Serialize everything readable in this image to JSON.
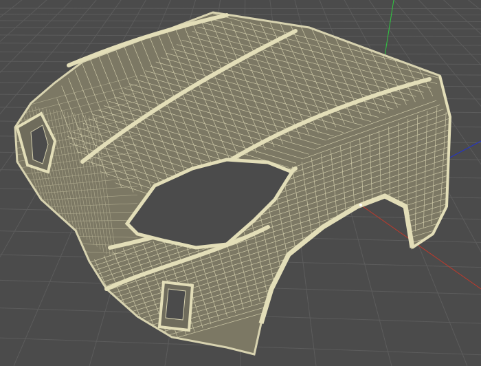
{
  "viewport": {
    "kind": "3d-perspective-viewport",
    "view_mode": "wireframe-on-shaded",
    "background_color": "#4b4b4b",
    "grid_color": "#5c5c5c",
    "grid_major_color": "#383838",
    "model": {
      "name": "",
      "description_icon": "car-front-body-mesh-icon",
      "surface_color": "#7c7864",
      "wire_color": "#d8d3b0",
      "cavity_color": "#4b4b4b"
    },
    "axes": {
      "x_color": "#c0392b",
      "y_color": "#2ecc40",
      "z_color": "#2233cc"
    }
  }
}
